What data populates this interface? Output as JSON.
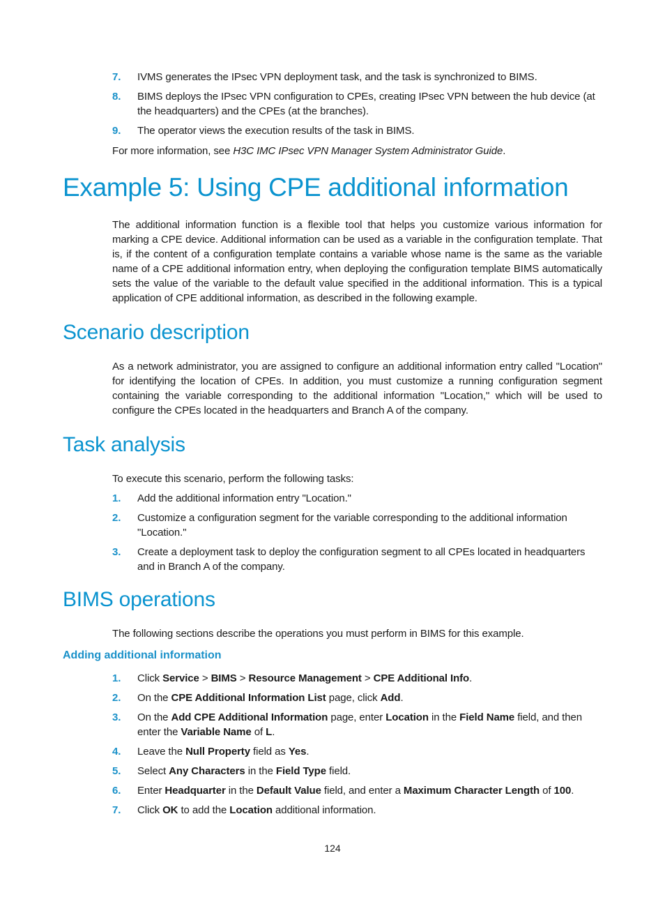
{
  "intro_list": [
    {
      "num": "7.",
      "text": "IVMS generates the IPsec VPN deployment task, and the task is synchronized to BIMS."
    },
    {
      "num": "8.",
      "text": "BIMS deploys the IPsec VPN configuration to CPEs, creating IPsec VPN between the hub device (at the headquarters) and the CPEs (at the branches)."
    },
    {
      "num": "9.",
      "text": "The operator views the execution results of the task in BIMS."
    }
  ],
  "more_info": {
    "prefix": "For more information, see ",
    "guide": "H3C IMC IPsec VPN Manager System Administrator Guide",
    "suffix": "."
  },
  "example_heading": "Example 5: Using CPE additional information",
  "example_intro": "The additional information function is a flexible tool that helps you customize various information for marking a CPE device. Additional information can be used as a variable in the configuration template. That is, if the content of a configuration template contains a variable whose name is the same as the variable name of a CPE additional information entry, when deploying the configuration template BIMS automatically sets the value of the variable to the default value specified in the additional information. This is a typical application of CPE additional information, as described in the following example.",
  "scenario": {
    "heading": "Scenario description",
    "text": "As a network administrator, you are assigned to configure an additional information entry called \"Location\" for identifying the location of CPEs. In addition, you must customize a running configuration segment containing the variable corresponding to the additional information \"Location,\" which will be used to configure the CPEs located in the headquarters and Branch A of the company."
  },
  "task_analysis": {
    "heading": "Task analysis",
    "intro": "To execute this scenario, perform the following tasks:",
    "items": [
      {
        "num": "1.",
        "text": "Add the additional information entry \"Location.\""
      },
      {
        "num": "2.",
        "text": "Customize a configuration segment for the variable corresponding to the additional information \"Location.\""
      },
      {
        "num": "3.",
        "text": "Create a deployment task to deploy the configuration segment to all CPEs located in headquarters and in Branch A of the company."
      }
    ]
  },
  "bims_operations": {
    "heading": "BIMS operations",
    "intro": "The following sections describe the operations you must perform in BIMS for this example.",
    "subheading": "Adding additional information",
    "steps": [
      {
        "num": "1.",
        "parts": [
          [
            "Click ",
            false
          ],
          [
            "Service",
            true
          ],
          [
            " > ",
            false
          ],
          [
            "BIMS",
            true
          ],
          [
            " > ",
            false
          ],
          [
            "Resource Management",
            true
          ],
          [
            " > ",
            false
          ],
          [
            "CPE Additional Info",
            true
          ],
          [
            ".",
            false
          ]
        ]
      },
      {
        "num": "2.",
        "parts": [
          [
            "On the ",
            false
          ],
          [
            "CPE Additional Information List",
            true
          ],
          [
            " page, click ",
            false
          ],
          [
            "Add",
            true
          ],
          [
            ".",
            false
          ]
        ]
      },
      {
        "num": "3.",
        "parts": [
          [
            "On the ",
            false
          ],
          [
            "Add CPE Additional Information",
            true
          ],
          [
            " page, enter ",
            false
          ],
          [
            "Location",
            true
          ],
          [
            " in the ",
            false
          ],
          [
            "Field Name",
            true
          ],
          [
            " field, and then enter the ",
            false
          ],
          [
            "Variable Name",
            true
          ],
          [
            " of ",
            false
          ],
          [
            "L",
            true
          ],
          [
            ".",
            false
          ]
        ]
      },
      {
        "num": "4.",
        "parts": [
          [
            "Leave the ",
            false
          ],
          [
            "Null Property",
            true
          ],
          [
            " field as ",
            false
          ],
          [
            "Yes",
            true
          ],
          [
            ".",
            false
          ]
        ]
      },
      {
        "num": "5.",
        "parts": [
          [
            "Select ",
            false
          ],
          [
            "Any Characters",
            true
          ],
          [
            " in the ",
            false
          ],
          [
            "Field Type",
            true
          ],
          [
            " field.",
            false
          ]
        ]
      },
      {
        "num": "6.",
        "parts": [
          [
            "Enter ",
            false
          ],
          [
            "Headquarter",
            true
          ],
          [
            " in the ",
            false
          ],
          [
            "Default Value",
            true
          ],
          [
            " field, and enter a ",
            false
          ],
          [
            "Maximum Character Length",
            true
          ],
          [
            " of ",
            false
          ],
          [
            "100",
            true
          ],
          [
            ".",
            false
          ]
        ]
      },
      {
        "num": "7.",
        "parts": [
          [
            "Click ",
            false
          ],
          [
            "OK",
            true
          ],
          [
            " to add the ",
            false
          ],
          [
            "Location",
            true
          ],
          [
            " additional information.",
            false
          ]
        ]
      }
    ]
  },
  "page_number": "124"
}
